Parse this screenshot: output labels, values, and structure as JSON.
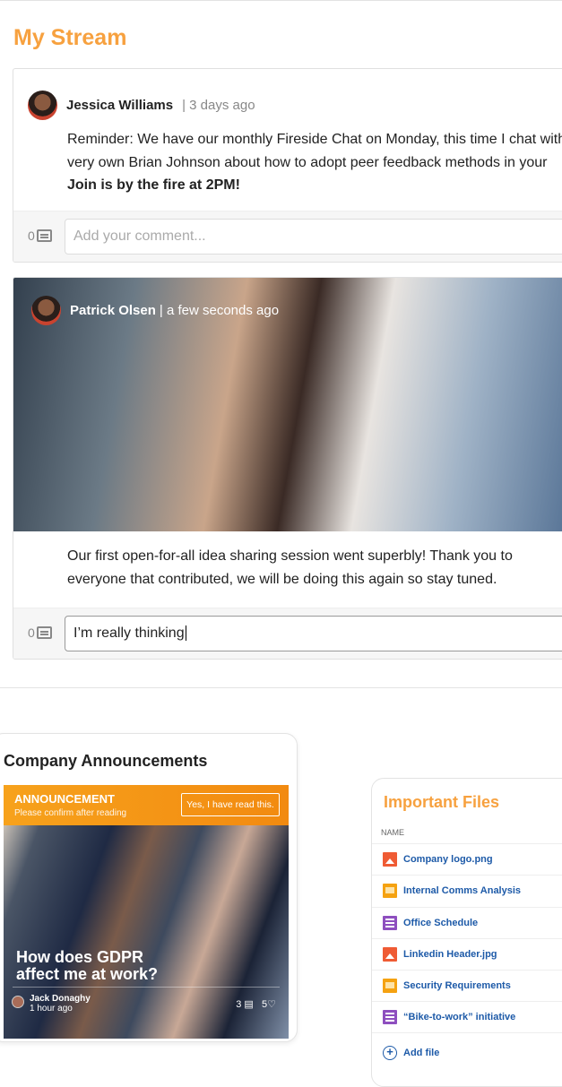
{
  "stream": {
    "title": "My Stream",
    "posts": [
      {
        "author": "Jessica Williams",
        "time": "| 3 days ago",
        "lines": [
          "Reminder: We have our monthly Fireside Chat on Monday, this time I chat with",
          "very own Brian Johnson about how to adopt peer feedback methods in your",
          "Join is by the fire at 2PM!"
        ],
        "comment_count": "0",
        "comment_placeholder": "Add your comment...",
        "comment_value": ""
      },
      {
        "author": "Patrick Olsen",
        "time": "| a few seconds ago",
        "lines": [
          "Our first open-for-all idea sharing session went superbly! Thank you to",
          "everyone that contributed, we will be doing this again so stay tuned."
        ],
        "comment_count": "0",
        "comment_placeholder": "",
        "comment_value": "I’m really thinking"
      }
    ]
  },
  "announcements": {
    "title": "Company Announcements",
    "label": "ANNOUNCEMENT",
    "sub": "Please confirm after reading",
    "confirm": "Yes, I have read this.",
    "headline": "How does GDPR affect me at work?",
    "author": "Jack Donaghy",
    "time": "1 hour ago",
    "comments": "3",
    "likes": "5"
  },
  "files": {
    "title": "Important Files",
    "column": "NAME",
    "items": [
      {
        "name": "Company logo.png",
        "icon": "image"
      },
      {
        "name": "Internal Comms Analysis",
        "icon": "slides"
      },
      {
        "name": "Office Schedule",
        "icon": "sheet"
      },
      {
        "name": "Linkedin Header.jpg",
        "icon": "image"
      },
      {
        "name": "Security Requirements",
        "icon": "slides"
      },
      {
        "name": "“Bike-to-work” initiative",
        "icon": "sheet"
      }
    ],
    "add": "Add file"
  }
}
